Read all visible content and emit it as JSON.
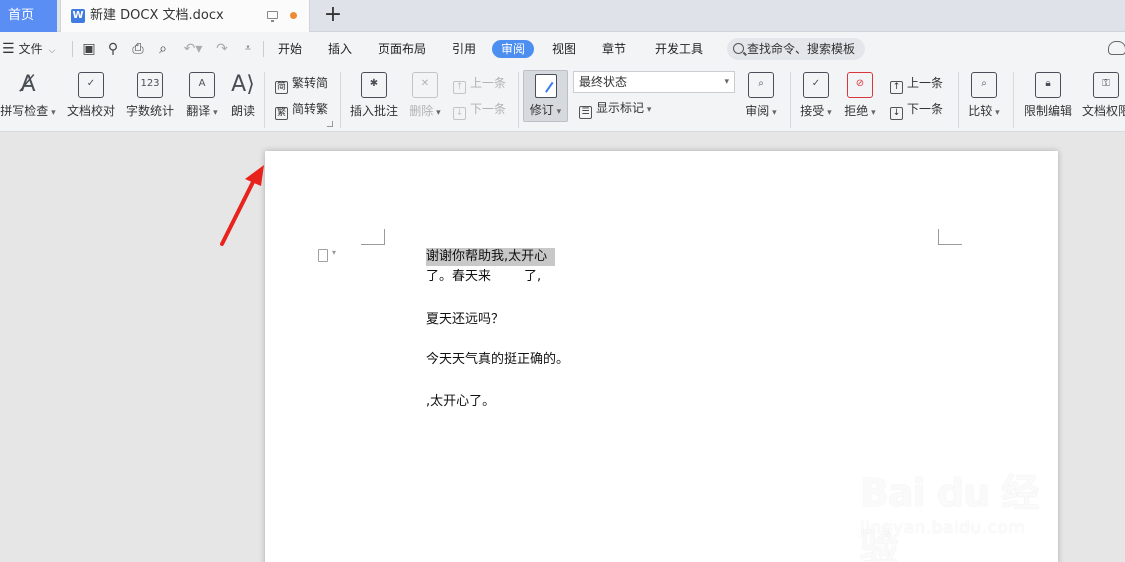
{
  "tabs": {
    "home": "首页",
    "doc_title": "新建 DOCX 文档.docx",
    "doc_logo": "W",
    "add": "+"
  },
  "menu": {
    "file": "文件",
    "tabs": [
      "开始",
      "插入",
      "页面布局",
      "引用",
      "审阅",
      "视图",
      "章节",
      "开发工具"
    ],
    "active_tab": "审阅",
    "search_placeholder": "查找命令、搜索模板"
  },
  "ribbon": {
    "spell_check": "拼写检查",
    "doc_proof": "文档校对",
    "word_count": "字数统计",
    "translate": "翻译",
    "read_aloud": "朗读",
    "trad_to_simp": "繁转简",
    "simp_to_trad": "简转繁",
    "insert_comment": "插入批注",
    "delete": "删除",
    "prev": "上一条",
    "next": "下一条",
    "track_changes": "修订",
    "final_state": "最终状态",
    "show_markup": "显示标记",
    "review": "审阅",
    "accept": "接受",
    "reject": "拒绝",
    "prev2": "上一条",
    "next2": "下一条",
    "compare": "比较",
    "restrict_edit": "限制编辑",
    "doc_permission": "文档权限"
  },
  "document": {
    "lines": [
      "谢谢你帮助我,太开心",
      "了。春天来        了,",
      "夏天还远吗？",
      "今天天气真的挺正确的。",
      ",太开心了。"
    ]
  },
  "watermark": {
    "logo": "Bai du 经验",
    "url": "jingyan.baidu.com"
  },
  "colors": {
    "accent": "#4d8ff0",
    "home_tab": "#5b8ef5",
    "annotation_arrow": "#e8231c",
    "unsaved_dot": "#f08a30"
  }
}
